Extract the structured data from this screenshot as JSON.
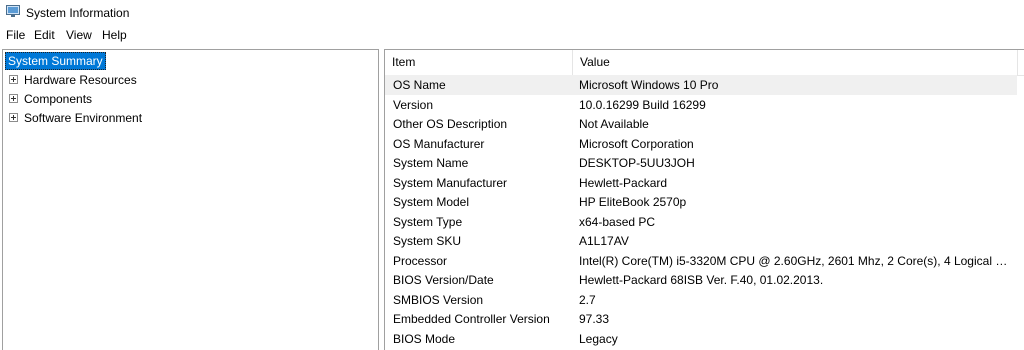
{
  "window": {
    "title": "System Information"
  },
  "menu": [
    "File",
    "Edit",
    "View",
    "Help"
  ],
  "tree": {
    "root": "System Summary",
    "children": [
      "Hardware Resources",
      "Components",
      "Software Environment"
    ]
  },
  "table": {
    "columns": [
      "Item",
      "Value"
    ],
    "rows": [
      {
        "item": "OS Name",
        "value": "Microsoft Windows 10 Pro"
      },
      {
        "item": "Version",
        "value": "10.0.16299 Build 16299"
      },
      {
        "item": "Other OS Description",
        "value": "Not Available"
      },
      {
        "item": "OS Manufacturer",
        "value": "Microsoft Corporation"
      },
      {
        "item": "System Name",
        "value": "DESKTOP-5UU3JOH"
      },
      {
        "item": "System Manufacturer",
        "value": "Hewlett-Packard"
      },
      {
        "item": "System Model",
        "value": "HP EliteBook 2570p"
      },
      {
        "item": "System Type",
        "value": "x64-based PC"
      },
      {
        "item": "System SKU",
        "value": "A1L17AV"
      },
      {
        "item": "Processor",
        "value": "Intel(R) Core(TM) i5-3320M CPU @ 2.60GHz, 2601 Mhz, 2 Core(s), 4 Logical Pr..."
      },
      {
        "item": "BIOS Version/Date",
        "value": "Hewlett-Packard 68ISB Ver. F.40, 01.02.2013."
      },
      {
        "item": "SMBIOS Version",
        "value": "2.7"
      },
      {
        "item": "Embedded Controller Version",
        "value": "97.33"
      },
      {
        "item": "BIOS Mode",
        "value": "Legacy"
      }
    ]
  }
}
